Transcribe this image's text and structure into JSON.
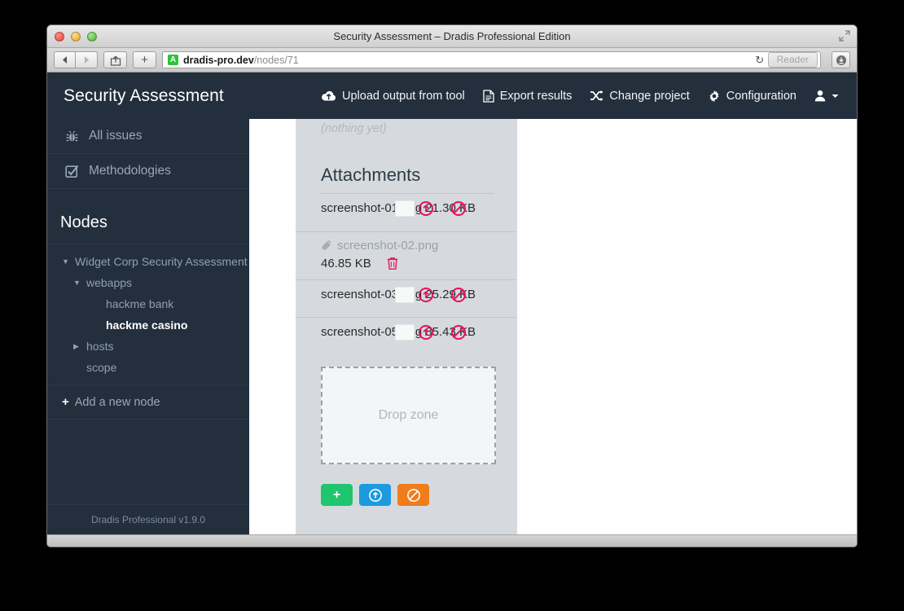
{
  "window": {
    "title": "Security Assessment – Dradis Professional Edition",
    "traffic_lights": [
      "close",
      "minimize",
      "zoom"
    ],
    "fullscreen_icon": "expand-icon"
  },
  "browser": {
    "back_icon": "back-arrow-icon",
    "forward_icon": "forward-arrow-icon",
    "share_icon": "share-icon",
    "newtab_label": "+",
    "ssl_badge": "A",
    "url_host": "dradis-pro.dev",
    "url_path": "/nodes/71",
    "reload_icon": "reload-icon",
    "reader_label": "Reader",
    "downloads_icon": "downloads-icon"
  },
  "app": {
    "brand": "Security Assessment",
    "version_footer": "Dradis Professional v1.9.0",
    "header_nav": [
      {
        "label": "Upload output from tool",
        "icon": "cloud-upload-icon"
      },
      {
        "label": "Export results",
        "icon": "document-icon"
      },
      {
        "label": "Change project",
        "icon": "shuffle-icon"
      },
      {
        "label": "Configuration",
        "icon": "gear-icon"
      },
      {
        "label": "",
        "icon": "user-icon"
      }
    ]
  },
  "sidebar": {
    "links": [
      {
        "label": "All issues",
        "icon": "bug-icon"
      },
      {
        "label": "Methodologies",
        "icon": "checkbox-icon"
      }
    ],
    "nodes_heading": "Nodes",
    "tree": [
      {
        "label": "Widget Corp Security Assessment",
        "level": 1,
        "caret": "down",
        "active": false
      },
      {
        "label": "webapps",
        "level": 2,
        "caret": "down",
        "active": false
      },
      {
        "label": "hackme bank",
        "level": 3,
        "caret": "none",
        "active": false
      },
      {
        "label": "hackme casino",
        "level": 3,
        "caret": "none",
        "active": true
      },
      {
        "label": "hosts",
        "level": 2,
        "caret": "right",
        "active": false
      },
      {
        "label": "scope",
        "level": 2,
        "caret": "none",
        "active": false
      }
    ],
    "add_node_label": "Add a new node"
  },
  "panel": {
    "nothing_yet": "(nothing yet)",
    "attachments_title": "Attachments",
    "attachments": [
      {
        "state": "uploading",
        "name": "screenshot-01.png",
        "size": "21.30 KB",
        "up_icon": "upload-circle-icon",
        "cancel_icon": "ban-circle-icon"
      },
      {
        "state": "done",
        "name": "screenshot-02.png",
        "size": "46.85 KB",
        "paperclip_icon": "paperclip-icon",
        "delete_icon": "trash-icon"
      },
      {
        "state": "uploading",
        "name": "screenshot-03.png",
        "size": "25.29 KB",
        "up_icon": "upload-circle-icon",
        "cancel_icon": "ban-circle-icon"
      },
      {
        "state": "uploading",
        "name": "screenshot-05.png",
        "size": "85.43 KB",
        "up_icon": "upload-circle-icon",
        "cancel_icon": "ban-circle-icon"
      }
    ],
    "dropzone_label": "Drop zone",
    "buttons": [
      {
        "name": "add-files-button",
        "glyph": "+",
        "color": "#1fc66d",
        "icon": "plus-icon"
      },
      {
        "name": "start-upload-button",
        "glyph": "",
        "color": "#1b9ae0",
        "icon": "upload-circle-icon"
      },
      {
        "name": "cancel-upload-button",
        "glyph": "",
        "color": "#f07c1a",
        "icon": "ban-circle-icon"
      }
    ]
  },
  "colors": {
    "sidebar_bg": "#232f3d",
    "panel_bg": "#d6dade",
    "accent_pink": "#e8115b",
    "green": "#1fc66d",
    "blue": "#1b9ae0",
    "orange": "#f07c1a"
  }
}
